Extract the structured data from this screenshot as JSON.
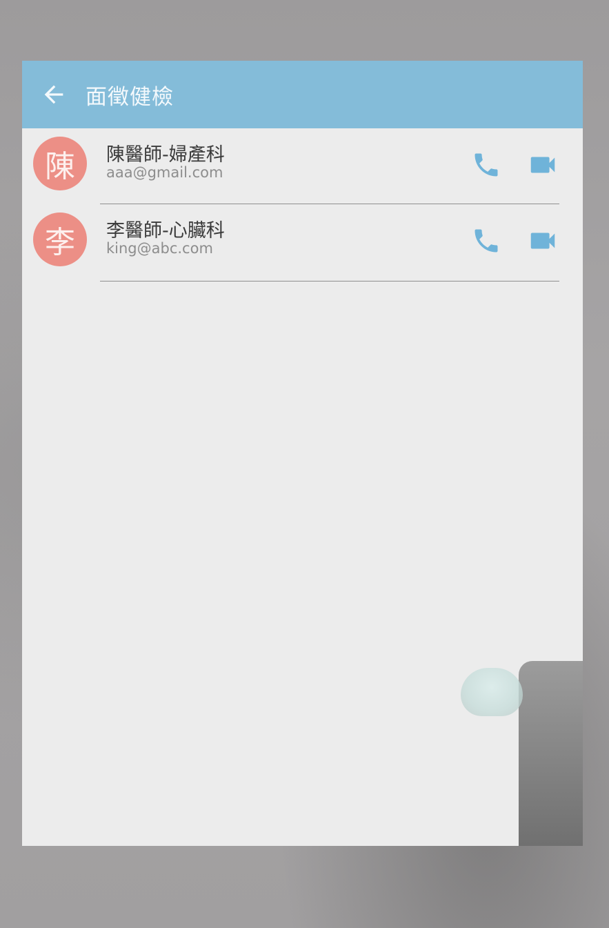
{
  "appbar": {
    "title": "面徵健檢",
    "back_icon": "arrow-back-icon",
    "background": "#84bcd9"
  },
  "contacts": [
    {
      "avatar_text": "陳",
      "name": "陳醫師-婦產科",
      "email": "aaa@gmail.com",
      "call_icon": "phone-icon",
      "video_icon": "video-camera-icon"
    },
    {
      "avatar_text": "李",
      "name": "李醫師-心臟科",
      "email": "king@abc.com",
      "call_icon": "phone-icon",
      "video_icon": "video-camera-icon"
    }
  ],
  "colors": {
    "avatar": "#ec8f86",
    "action_icon": "#6fb3d9",
    "screen_background": "#ececec"
  }
}
